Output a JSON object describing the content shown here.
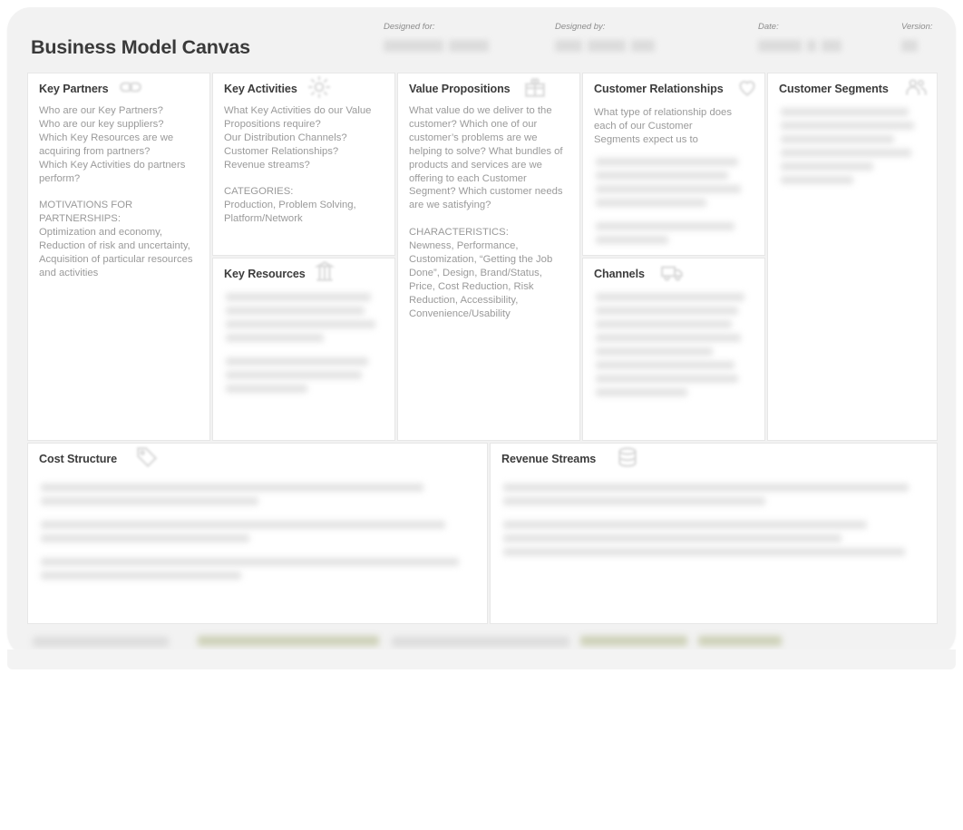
{
  "header": {
    "title": "Business Model Canvas",
    "fields": [
      {
        "label": "Designed for:",
        "value": "",
        "legible": false
      },
      {
        "label": "Designed by:",
        "value": "",
        "legible": false
      },
      {
        "label": "Date:",
        "value": "",
        "legible": false
      },
      {
        "label": "Version:",
        "value": "",
        "legible": false
      }
    ]
  },
  "blocks": {
    "key_partners": {
      "title": "Key Partners",
      "icon": "chain-links-icon",
      "legible": true,
      "body": "Who are our Key Partners?\nWho are our key suppliers?\nWhich Key Resources are we acquiring from partners?\nWhich Key Activities do partners perform?\n\nMOTIVATIONS FOR PARTNERSHIPS:\nOptimization and economy, Reduction of risk and uncertainty, Acquisition of particular resources and activities"
    },
    "key_activities": {
      "title": "Key Activities",
      "icon": "gear-icon",
      "legible": true,
      "body": "What Key Activities do our Value Propositions require?\nOur Distribution Channels?\nCustomer Relationships?\nRevenue streams?\n\nCATEGORIES:\nProduction, Problem Solving, Platform/Network"
    },
    "key_resources": {
      "title": "Key Resources",
      "icon": "pillar-icon",
      "legible": false,
      "body": ""
    },
    "value_propositions": {
      "title": "Value Propositions",
      "icon": "gift-box-icon",
      "legible": true,
      "body": "What value do we deliver to the customer? Which one of our customer’s problems are we helping to solve? What bundles of products and services are we offering to each Customer Segment? Which customer needs are we satisfying?\n\nCHARACTERISTICS:\nNewness, Performance, Customization, “Getting the Job Done”, Design, Brand/Status, Price, Cost Reduction, Risk Reduction, Accessibility, Convenience/Usability"
    },
    "customer_relationships": {
      "title": "Customer Relationships",
      "icon": "heart-icon",
      "legible": "partial",
      "body": "What type of relationship does each of our Customer\nSegments expect us to"
    },
    "channels": {
      "title": "Channels",
      "icon": "truck-icon",
      "legible": false,
      "body": ""
    },
    "customer_segments": {
      "title": "Customer Segments",
      "icon": "people-icon",
      "legible": false,
      "body": ""
    },
    "cost_structure": {
      "title": "Cost Structure",
      "icon": "price-tag-icon",
      "legible": false,
      "body": ""
    },
    "revenue_streams": {
      "title": "Revenue Streams",
      "icon": "coins-icon",
      "legible": false,
      "body": ""
    }
  },
  "footer": {
    "legible": false,
    "accent_color": "#c9cdb0"
  },
  "colors": {
    "page_background": "#ffffff",
    "canvas_background": "#f2f2f2",
    "block_background": "#ffffff",
    "block_border": "#e7e7e7",
    "heading_text": "#3c3c3c",
    "body_text": "#9a9a9a",
    "meta_label_text": "#8c8c8c",
    "footer_accent": "#c9cdb0"
  }
}
